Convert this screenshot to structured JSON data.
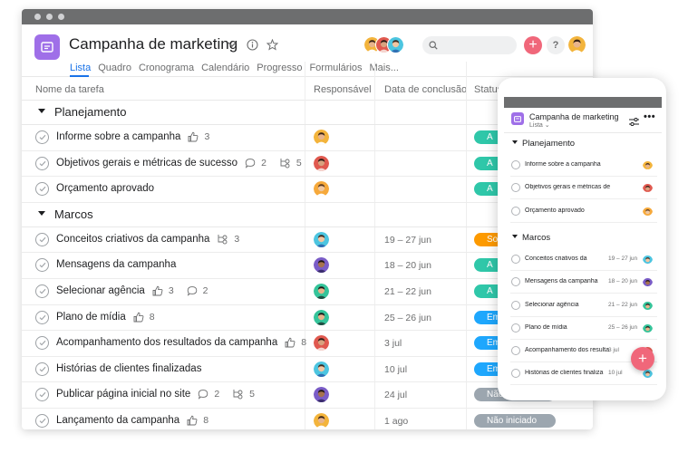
{
  "colors": {
    "brand_purple": "#9f6fe8",
    "accent_blue": "#1a73e8",
    "add_pink": "#f0677a",
    "status_teal": "#2fc7a9",
    "status_orange": "#fd9a00",
    "status_blue": "#1ea7fd",
    "status_gray": "#9ca6af"
  },
  "header": {
    "title": "Campanha de marketing",
    "title_icon": "board-icon",
    "tabs": [
      {
        "label": "Lista",
        "active": true
      },
      {
        "label": "Quadro"
      },
      {
        "label": "Cronograma"
      },
      {
        "label": "Calendário"
      },
      {
        "label": "Progresso"
      },
      {
        "label": "Formulários"
      },
      {
        "label": "Mais..."
      }
    ]
  },
  "columns": {
    "name": "Nome da tarefa",
    "assignee": "Responsável",
    "due": "Data de conclusão",
    "status": "Status"
  },
  "sections": [
    {
      "name": "Planejamento",
      "tasks": [
        {
          "name": "Informe sobre a campanha",
          "likes": "3",
          "avatar": "a",
          "status": "A",
          "status_color": "#2fc7a9"
        },
        {
          "name": "Objetivos gerais e métricas de sucesso",
          "comments": "2",
          "subtasks": "5",
          "avatar": "b",
          "status": "A",
          "status_color": "#2fc7a9"
        },
        {
          "name": "Orçamento aprovado",
          "avatar": "c",
          "status": "A",
          "status_color": "#2fc7a9"
        }
      ]
    },
    {
      "name": "Marcos",
      "tasks": [
        {
          "name": "Conceitos criativos da campanha",
          "subtasks": "3",
          "avatar": "d",
          "due": "19 – 27 jun",
          "status": "So",
          "status_color": "#fd9a00"
        },
        {
          "name": "Mensagens da campanha",
          "avatar": "e",
          "due": "18 – 20 jun",
          "status": "A",
          "status_color": "#2fc7a9"
        },
        {
          "name": "Selecionar agência",
          "likes": "3",
          "comments": "2",
          "avatar": "f",
          "due": "21 – 22 jun",
          "status": "A",
          "status_color": "#2fc7a9"
        },
        {
          "name": "Plano de mídia",
          "likes": "8",
          "avatar": "f",
          "due": "25 – 26 jun",
          "status": "Em a",
          "status_color": "#1ea7fd"
        },
        {
          "name": "Acompanhamento dos resultados da campanha",
          "likes": "8",
          "avatar": "b",
          "due": "3 jul",
          "status": "Em a",
          "status_color": "#1ea7fd"
        },
        {
          "name": "Histórias de clientes finalizadas",
          "avatar": "d",
          "due": "10 jul",
          "status": "Em a",
          "status_color": "#1ea7fd"
        },
        {
          "name": "Publicar página inicial no site",
          "comments": "2",
          "subtasks": "5",
          "avatar": "e",
          "due": "24 jul",
          "status": "Não",
          "status_color": "#9ca6af"
        },
        {
          "name": "Lançamento da campanha",
          "likes": "8",
          "avatar": "a",
          "due": "1 ago",
          "status": "Não iniciado",
          "status_color": "#9ca6af"
        }
      ]
    }
  ],
  "mobile": {
    "title": "Campanha de marketing",
    "view": "Lista",
    "sections": [
      {
        "name": "Planejamento",
        "tasks": [
          {
            "name": "Informe sobre a campanha",
            "avatar": "a"
          },
          {
            "name": "Objetivos gerais e métricas de suc",
            "avatar": "b"
          },
          {
            "name": "Orçamento aprovado",
            "avatar": "c"
          }
        ]
      },
      {
        "name": "Marcos",
        "tasks": [
          {
            "name": "Conceitos criativos da",
            "due": "19 – 27 jun",
            "avatar": "d"
          },
          {
            "name": "Mensagens da campanha",
            "due": "18 – 20 jun",
            "avatar": "e"
          },
          {
            "name": "Selecionar agência",
            "due": "21 – 22 jun",
            "avatar": "f"
          },
          {
            "name": "Plano de mídia",
            "due": "25 – 26 jun",
            "avatar": "f"
          },
          {
            "name": "Acompanhamento dos resulta",
            "due": "3 jul",
            "avatar": "b"
          },
          {
            "name": "Histórias de clientes finaliza",
            "due": "10 jul",
            "avatar": "d"
          }
        ]
      }
    ]
  }
}
